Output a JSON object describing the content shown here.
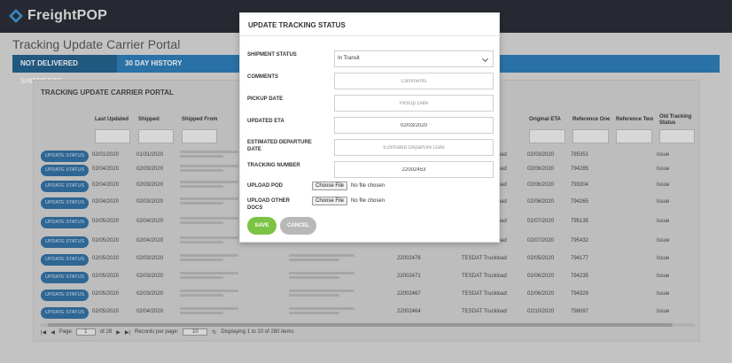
{
  "app": {
    "logo_text": "FreightPOP"
  },
  "page": {
    "title": "Tracking Update Carrier Portal"
  },
  "tabs": [
    {
      "label": "NOT DELIVERED SHIPMENTS",
      "active": true
    },
    {
      "label": "30 DAY HISTORY",
      "active": false
    }
  ],
  "panel": {
    "title": "TRACKING UPDATE CARRIER PORTAL"
  },
  "columns": {
    "last_updated": "Last Updated",
    "shipped": "Shipped",
    "shipped_from": "Shipped From",
    "original_eta": "Original ETA",
    "reference_one": "Reference One",
    "reference_two": "Reference Two",
    "old_tracking_status": "Old Tracking Status"
  },
  "rows": [
    {
      "button": "UPDATE STATUS",
      "last_updated": "02/01/2020",
      "shipped": "01/31/2020",
      "tracking": "",
      "carrier": "TESDAT Truckload",
      "original_eta": "02/03/2020",
      "reference_one": "785351",
      "status": "Issue"
    },
    {
      "button": "UPDATE STATUS",
      "last_updated": "02/04/2020",
      "shipped": "02/03/2020",
      "tracking": "",
      "carrier": "TESDAT Truckload",
      "original_eta": "02/06/2020",
      "reference_one": "794285",
      "status": "Issue"
    },
    {
      "button": "UPDATE STATUS",
      "last_updated": "02/04/2020",
      "shipped": "02/03/2020",
      "tracking": "",
      "carrier": "TESDAT Truckload",
      "original_eta": "02/06/2020",
      "reference_one": "793304",
      "status": "Issue"
    },
    {
      "button": "UPDATE STATUS",
      "last_updated": "02/04/2020",
      "shipped": "02/03/2020",
      "tracking": "",
      "carrier": "TESDAT Truckload",
      "original_eta": "02/06/2020",
      "reference_one": "794265",
      "status": "Issue"
    },
    {
      "button": "UPDATE STATUS",
      "last_updated": "02/05/2020",
      "shipped": "02/04/2020",
      "tracking": "",
      "carrier": "TESDAT Truckload",
      "original_eta": "02/07/2020",
      "reference_one": "795135",
      "status": "Issue"
    },
    {
      "button": "UPDATE STATUS",
      "last_updated": "02/05/2020",
      "shipped": "02/04/2020",
      "tracking": "",
      "carrier": "TESDAT Truckload",
      "original_eta": "02/07/2020",
      "reference_one": "795432",
      "status": "Issue"
    },
    {
      "button": "UPDATE STATUS",
      "last_updated": "02/05/2020",
      "shipped": "02/03/2020",
      "tracking": "22002476",
      "carrier": "TESDAT Truckload",
      "original_eta": "02/05/2020",
      "reference_one": "794177",
      "status": "Issue"
    },
    {
      "button": "UPDATE STATUS",
      "last_updated": "02/05/2020",
      "shipped": "02/03/2020",
      "tracking": "22002471",
      "carrier": "TESDAT Truckload",
      "original_eta": "02/06/2020",
      "reference_one": "794235",
      "status": "Issue"
    },
    {
      "button": "UPDATE STATUS",
      "last_updated": "02/05/2020",
      "shipped": "02/03/2020",
      "tracking": "22002467",
      "carrier": "TESDAT Truckload",
      "original_eta": "02/06/2020",
      "reference_one": "794329",
      "status": "Issue"
    },
    {
      "button": "UPDATE STATUS",
      "last_updated": "02/05/2020",
      "shipped": "02/04/2020",
      "tracking": "22002464",
      "carrier": "TESDAT Truckload",
      "original_eta": "02/10/2020",
      "reference_one": "798097",
      "status": "Issue"
    }
  ],
  "pager": {
    "page_label": "Page",
    "page_value": "1",
    "of_label": "of 28",
    "records_label": "Records per page:",
    "records_value": "10",
    "summary": "Displaying 1 to 10 of 280 items"
  },
  "modal": {
    "title": "UPDATE TRACKING STATUS",
    "shipment_status_label": "SHIPMENT STATUS",
    "shipment_status_value": "In Transit",
    "comments_label": "COMMENTS",
    "comments_placeholder": "Comments",
    "pickup_date_label": "PICKUP DATE",
    "pickup_date_placeholder": "Pickup Date",
    "updated_eta_label": "UPDATED ETA",
    "updated_eta_value": "02/03/2020",
    "est_departure_label": "ESTIMATED DEPARTURE DATE",
    "est_departure_placeholder": "Estimated Departure Date",
    "tracking_number_label": "TRACKING NUMBER",
    "tracking_number_value": "22002453",
    "upload_pod_label": "UPLOAD POD",
    "upload_other_label": "UPLOAD OTHER DOCS",
    "choose_file_label": "Choose File",
    "no_file_text": "No file chosen",
    "save_label": "SAVE",
    "cancel_label": "CANCEL"
  },
  "colors": {
    "topbar": "#262a33",
    "tab_blue": "#2a7cb8",
    "save_green": "#7cc243",
    "status_button": "#2f6fa3"
  }
}
